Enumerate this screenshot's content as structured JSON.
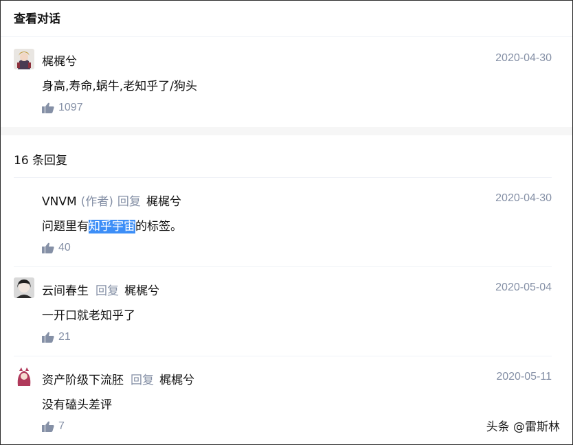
{
  "header": {
    "title": "查看对话"
  },
  "main_comment": {
    "author": "梶梶兮",
    "date": "2020-04-30",
    "text": "身高,寿命,蜗牛,老知乎了/狗头",
    "likes": "1097"
  },
  "replies_header": "16 条回复",
  "replies": [
    {
      "author": "VNVM",
      "author_tag": "(作者)",
      "reply_word": "回复",
      "reply_to": "梶梶兮",
      "date": "2020-04-30",
      "text_before": "问题里有",
      "text_highlight": "知乎宇宙",
      "text_after": "的标签。",
      "likes": "40"
    },
    {
      "author": "云间春生",
      "reply_word": "回复",
      "reply_to": "梶梶兮",
      "date": "2020-05-04",
      "text": "一开口就老知乎了",
      "likes": "21"
    },
    {
      "author": "资产阶级下流胚",
      "reply_word": "回复",
      "reply_to": "梶梶兮",
      "date": "2020-05-11",
      "text": "没有磕头差评",
      "likes": "7"
    }
  ],
  "watermark": "头条 @雷斯林",
  "colors": {
    "muted": "#8590a6",
    "highlight": "#3d8ef7",
    "text": "#121212",
    "band": "#f6f6f6"
  },
  "icons": {
    "like": "thumbs-up-icon"
  }
}
